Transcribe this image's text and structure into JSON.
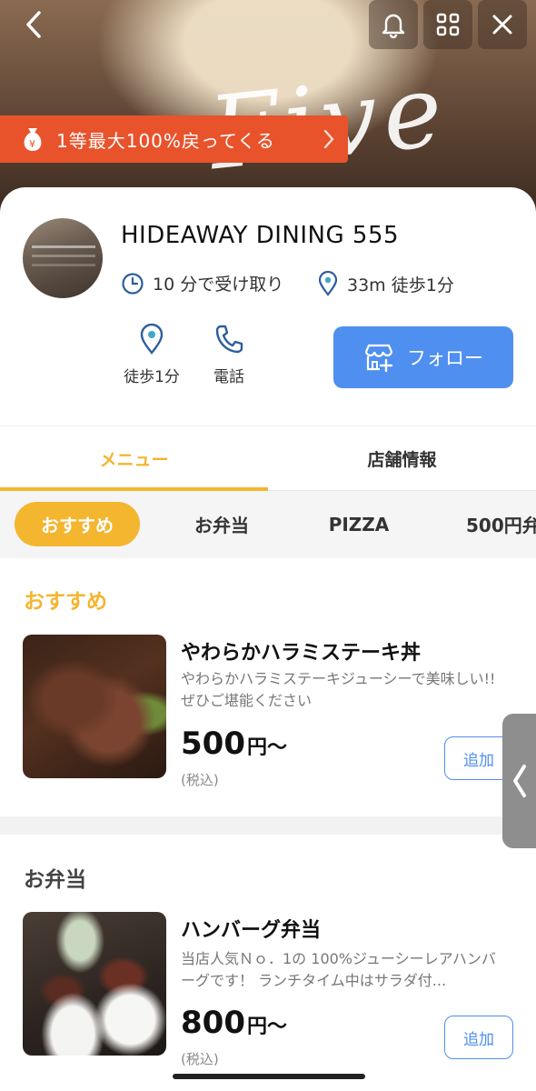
{
  "header": {
    "hero_script": "Five",
    "back_icon": "chevron-left-icon",
    "actions": [
      "bell-icon",
      "grid-icon",
      "close-icon"
    ]
  },
  "promo": {
    "text": "1等最大100%戻ってくる"
  },
  "shop": {
    "name": "HIDEAWAY DINING 555",
    "pickup": "10 分で受け取り",
    "distance": "33m 徒歩1分",
    "actions": [
      {
        "label": "徒歩1分",
        "icon": "location-pin-icon"
      },
      {
        "label": "電話",
        "icon": "phone-icon"
      }
    ],
    "follow_label": "フォロー"
  },
  "tabs": [
    {
      "label": "メニュー",
      "active": true
    },
    {
      "label": "店舗情報",
      "active": false
    }
  ],
  "categories": [
    "おすすめ",
    "お弁当",
    "PIZZA",
    "500円弁"
  ],
  "sections": [
    {
      "title": "おすすめ",
      "items": [
        {
          "name": "やわらかハラミステーキ丼",
          "desc": "やわらかハラミステーキジューシーで美味しい!!ぜひご堪能ください",
          "price": "500",
          "suffix": "円〜",
          "tax": "(税込)",
          "add": "追加"
        }
      ]
    },
    {
      "title": "お弁当",
      "items": [
        {
          "name": "ハンバーグ弁当",
          "desc": "当店人気Ｎｏ．1の 100%ジューシーレアハンバーグです！ ランチタイム中はサラダ付...",
          "price": "800",
          "suffix": "円〜",
          "tax": "(税込)",
          "add": "追加"
        }
      ]
    }
  ],
  "colors": {
    "accent": "#f4b52f",
    "primary": "#4f8ff0",
    "promo": "#e8532c"
  }
}
